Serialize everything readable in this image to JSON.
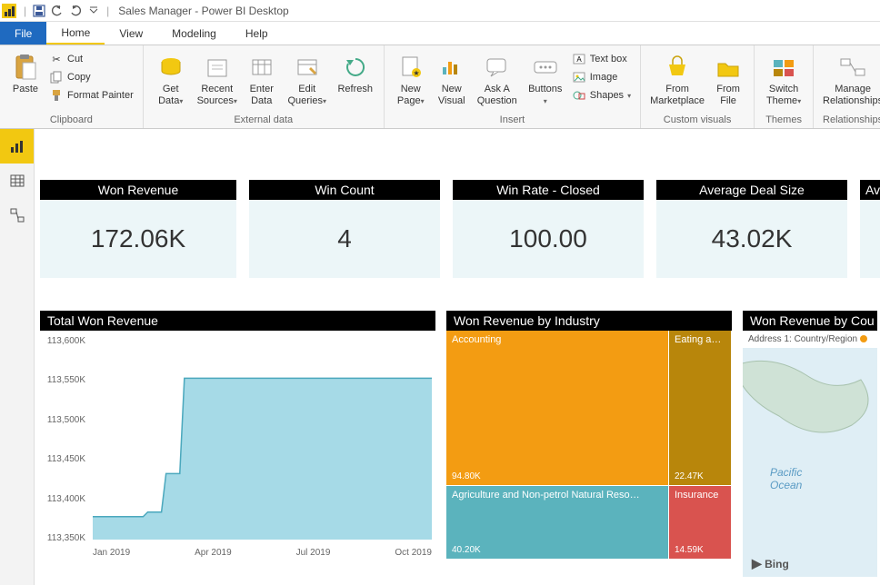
{
  "title": "Sales Manager - Power BI Desktop",
  "menu": {
    "file": "File",
    "home": "Home",
    "view": "View",
    "modeling": "Modeling",
    "help": "Help"
  },
  "ribbon": {
    "clipboard": {
      "label": "Clipboard",
      "paste": "Paste",
      "cut": "Cut",
      "copy": "Copy",
      "format_painter": "Format Painter"
    },
    "external": {
      "label": "External data",
      "get_data": "Get\nData",
      "recent": "Recent\nSources",
      "enter": "Enter\nData",
      "edit_q": "Edit\nQueries",
      "refresh": "Refresh"
    },
    "insert": {
      "label": "Insert",
      "new_page": "New\nPage",
      "new_visual": "New\nVisual",
      "ask": "Ask A\nQuestion",
      "buttons": "Buttons",
      "textbox": "Text box",
      "image": "Image",
      "shapes": "Shapes"
    },
    "custom": {
      "label": "Custom visuals",
      "marketplace": "From\nMarketplace",
      "file": "From\nFile"
    },
    "themes": {
      "label": "Themes",
      "switch": "Switch\nTheme"
    },
    "relationships": {
      "label": "Relationships",
      "manage": "Manage\nRelationships"
    }
  },
  "kpi": [
    {
      "title": "Won Revenue",
      "value": "172.06K"
    },
    {
      "title": "Win Count",
      "value": "4"
    },
    {
      "title": "Win Rate - Closed",
      "value": "100.00"
    },
    {
      "title": "Average Deal Size",
      "value": "43.02K"
    },
    {
      "title": "Av",
      "value": ""
    }
  ],
  "charts": {
    "line": {
      "title": "Total Won Revenue"
    },
    "tree": {
      "title": "Won Revenue by Industry",
      "accounting": {
        "label": "Accounting",
        "value": "94.80K"
      },
      "agriculture": {
        "label": "Agriculture and Non-petrol Natural Reso…",
        "value": "40.20K"
      },
      "eating": {
        "label": "Eating a…",
        "value": "22.47K"
      },
      "insurance": {
        "label": "Insurance",
        "value": "14.59K"
      }
    },
    "map": {
      "title": "Won Revenue by Cou",
      "legend": "Address 1: Country/Region",
      "ocean": "Pacific\nOcean",
      "bing": "Bing"
    }
  },
  "chart_data": [
    {
      "type": "area",
      "title": "Total Won Revenue",
      "xlabel": "",
      "ylabel": "",
      "ylim": [
        113350,
        113600
      ],
      "y_ticks": [
        "113,600K",
        "113,550K",
        "113,500K",
        "113,450K",
        "113,400K",
        "113,350K"
      ],
      "x_ticks": [
        "Jan 2019",
        "Apr 2019",
        "Jul 2019",
        "Oct 2019"
      ],
      "series": [
        {
          "name": "Won Revenue",
          "x": [
            "Jan 2019",
            "Feb 2019",
            "Mar 2019",
            "Apr 2019",
            "Jul 2019",
            "Oct 2019",
            "Dec 2019"
          ],
          "values": [
            113378,
            113378,
            113432,
            113550,
            113550,
            113550,
            113550
          ]
        }
      ]
    },
    {
      "type": "treemap",
      "title": "Won Revenue by Industry",
      "categories": [
        "Accounting",
        "Agriculture and Non-petrol Natural Resources",
        "Eating and Drinking",
        "Insurance"
      ],
      "values": [
        94.8,
        40.2,
        22.47,
        14.59
      ],
      "unit": "K"
    }
  ]
}
